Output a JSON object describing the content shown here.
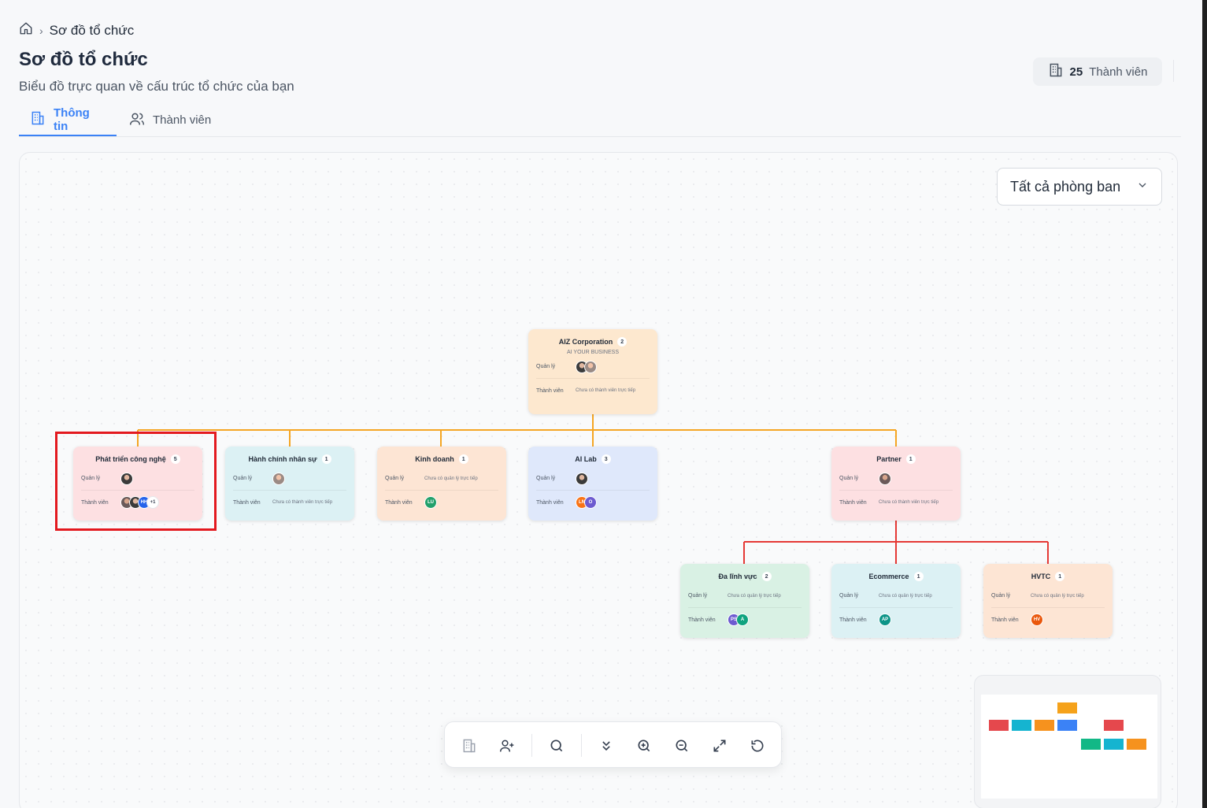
{
  "breadcrumb": {
    "home_icon": "home-icon",
    "current": "Sơ đồ tổ chức"
  },
  "header": {
    "title": "Sơ đồ tổ chức",
    "subtitle": "Biểu đồ trực quan về cấu trúc tổ chức của bạn",
    "member_count": "25",
    "member_label": "Thành viên"
  },
  "tabs": [
    {
      "label": "Thông tin",
      "icon": "building-icon",
      "active": true
    },
    {
      "label": "Thành viên",
      "icon": "users-icon",
      "active": false
    }
  ],
  "filter": {
    "selected": "Tất cả phòng ban"
  },
  "labels": {
    "manager": "Quản lý",
    "members": "Thành viên",
    "no_members": "Chưa có thành viên trực tiếp",
    "no_manager": "Chưa có quản lý trực tiếp"
  },
  "nodes": {
    "root": {
      "name": "AIZ Corporation",
      "count": "2",
      "tagline": "AI YOUR BUSINESS"
    },
    "tech": {
      "name": "Phát triển công nghệ",
      "count": "5",
      "member_initials": "HH",
      "more": "+1"
    },
    "hr": {
      "name": "Hành chính nhân sự",
      "count": "1"
    },
    "sales": {
      "name": "Kinh doanh",
      "count": "1",
      "member_initials": "LU"
    },
    "ailab": {
      "name": "AI Lab",
      "count": "3",
      "member_initials": [
        "LN",
        "O"
      ]
    },
    "partner": {
      "name": "Partner",
      "count": "1"
    },
    "multi": {
      "name": "Đa lĩnh vực",
      "count": "2",
      "member_initials": [
        "PS",
        "A"
      ]
    },
    "ecom": {
      "name": "Ecommerce",
      "count": "1",
      "member_initials": "AP"
    },
    "hvtc": {
      "name": "HVTC",
      "count": "1",
      "member_initials": "HV"
    }
  },
  "toolbar": {
    "icons": [
      "building-icon",
      "add-user-icon",
      "search-icon",
      "collapse-icon",
      "zoom-in-icon",
      "zoom-out-icon",
      "fullscreen-icon",
      "reset-icon"
    ]
  },
  "colors": {
    "accent": "#3b82f6",
    "edge_primary": "#f5a623",
    "edge_secondary": "#e53935",
    "highlight": "#e3191f"
  }
}
